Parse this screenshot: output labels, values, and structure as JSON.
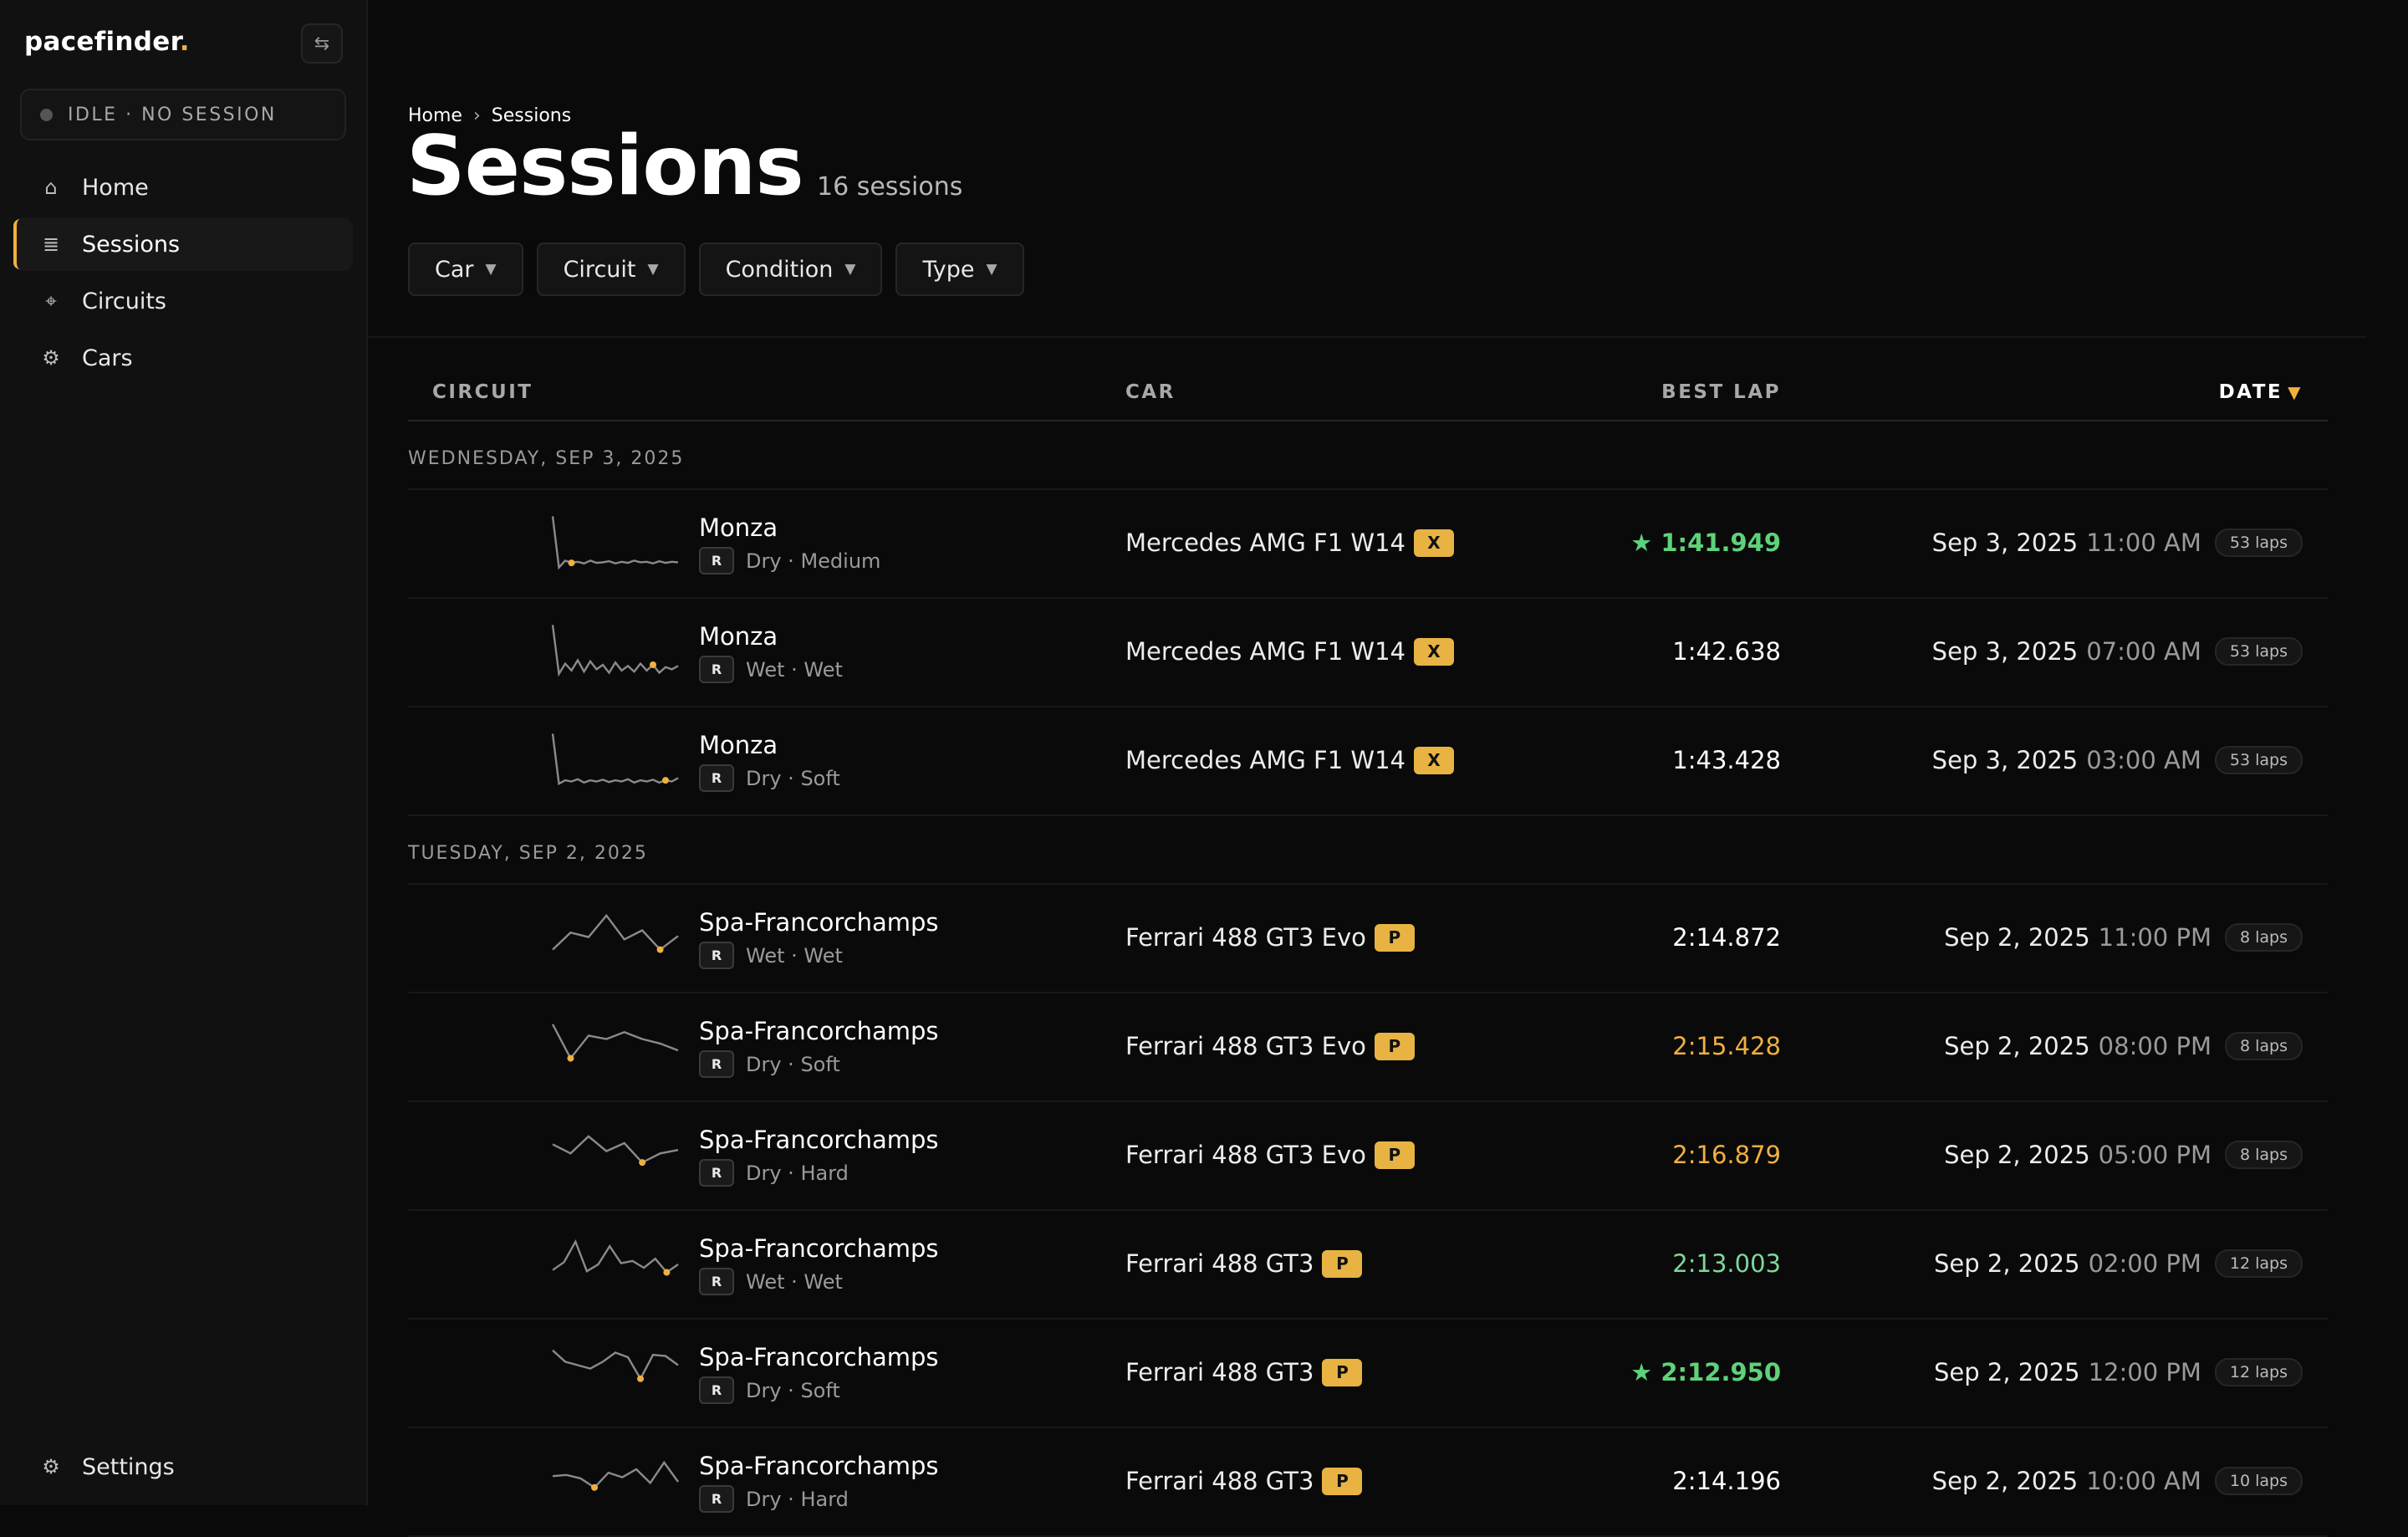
{
  "app": {
    "brand": "pacefinder",
    "brand_dot": "."
  },
  "status": {
    "text": "IDLE · NO SESSION"
  },
  "nav": {
    "items": [
      {
        "label": "Home",
        "icon": "⌂"
      },
      {
        "label": "Sessions",
        "icon": "≣"
      },
      {
        "label": "Circuits",
        "icon": "⌖"
      },
      {
        "label": "Cars",
        "icon": "⚙"
      }
    ],
    "settings": {
      "label": "Settings",
      "icon": "⚙"
    }
  },
  "page": {
    "breadcrumb": {
      "home": "Home",
      "sep": "›",
      "current": "Sessions"
    },
    "title": "Sessions",
    "count": "16 sessions"
  },
  "filters": [
    {
      "label": "Car"
    },
    {
      "label": "Circuit"
    },
    {
      "label": "Condition"
    },
    {
      "label": "Type"
    }
  ],
  "table": {
    "headers": {
      "circuit": "CIRCUIT",
      "car": "CAR",
      "best_lap": "BEST LAP",
      "date": "DATE",
      "sort_icon": "▼"
    },
    "groups": [
      {
        "label": "WEDNESDAY, SEP 3, 2025",
        "rows": [
          {
            "circuit": "Monza",
            "badge": "R",
            "conditions": "Dry · Medium",
            "car": "Mercedes AMG F1 W14",
            "car_class": "X",
            "best_lap": "★ 1:41.949",
            "best_style": "pb",
            "date": "Sep 3, 2025",
            "time": "11:00 AM",
            "laps": "53 laps",
            "spark": [
              2,
              92,
              80,
              84,
              82,
              85,
              80,
              84,
              83,
              81,
              85,
              82,
              84,
              80,
              83,
              82,
              85,
              81,
              84,
              82,
              83
            ],
            "spark_best": 3
          },
          {
            "circuit": "Monza",
            "badge": "R",
            "conditions": "Wet · Wet",
            "car": "Mercedes AMG F1 W14",
            "car_class": "X",
            "best_lap": "1:42.638",
            "best_style": "normal",
            "date": "Sep 3, 2025",
            "time": "07:00 AM",
            "laps": "53 laps",
            "spark": [
              2,
              88,
              70,
              82,
              64,
              84,
              66,
              80,
              72,
              86,
              68,
              82,
              74,
              84,
              70,
              82,
              72,
              86,
              76,
              80,
              74
            ],
            "spark_best": 16
          },
          {
            "circuit": "Monza",
            "badge": "R",
            "conditions": "Dry · Soft",
            "car": "Mercedes AMG F1 W14",
            "car_class": "X",
            "best_lap": "1:43.428",
            "best_style": "normal",
            "date": "Sep 3, 2025",
            "time": "03:00 AM",
            "laps": "53 laps",
            "spark": [
              2,
              90,
              84,
              86,
              82,
              88,
              84,
              86,
              83,
              87,
              84,
              86,
              82,
              88,
              84,
              86,
              83,
              88,
              84,
              86,
              80
            ],
            "spark_best": 18
          }
        ]
      },
      {
        "label": "TUESDAY, SEP 2, 2025",
        "rows": [
          {
            "circuit": "Spa-Francorchamps",
            "badge": "R",
            "conditions": "Wet · Wet",
            "car": "Ferrari 488 GT3 Evo",
            "car_class": "P",
            "best_lap": "2:14.872",
            "best_style": "normal",
            "date": "Sep 2, 2025",
            "time": "11:00 PM",
            "laps": "8 laps",
            "spark": [
              70,
              40,
              48,
              10,
              52,
              36,
              70,
              46
            ],
            "spark_best": 6
          },
          {
            "circuit": "Spa-Francorchamps",
            "badge": "R",
            "conditions": "Dry · Soft",
            "car": "Ferrari 488 GT3 Evo",
            "car_class": "P",
            "best_lap": "2:15.428",
            "best_style": "orange",
            "date": "Sep 2, 2025",
            "time": "08:00 PM",
            "laps": "8 laps",
            "spark": [
              10,
              70,
              30,
              36,
              24,
              36,
              44,
              56
            ],
            "spark_best": 1
          },
          {
            "circuit": "Spa-Francorchamps",
            "badge": "R",
            "conditions": "Dry · Hard",
            "car": "Ferrari 488 GT3 Evo",
            "car_class": "P",
            "best_lap": "2:16.879",
            "best_style": "orange",
            "date": "Sep 2, 2025",
            "time": "05:00 PM",
            "laps": "8 laps",
            "spark": [
              30,
              46,
              16,
              42,
              28,
              62,
              46,
              40
            ],
            "spark_best": 5
          },
          {
            "circuit": "Spa-Francorchamps",
            "badge": "R",
            "conditions": "Wet · Wet",
            "car": "Ferrari 488 GT3",
            "car_class": "P",
            "best_lap": "2:13.003",
            "best_style": "green",
            "date": "Sep 2, 2025",
            "time": "02:00 PM",
            "laps": "12 laps",
            "spark": [
              60,
              46,
              10,
              62,
              50,
              18,
              48,
              44,
              56,
              40,
              64,
              50
            ],
            "spark_best": 10
          },
          {
            "circuit": "Spa-Francorchamps",
            "badge": "R",
            "conditions": "Dry · Soft",
            "car": "Ferrari 488 GT3",
            "car_class": "P",
            "best_lap": "★ 2:12.950",
            "best_style": "pb",
            "date": "Sep 2, 2025",
            "time": "12:00 PM",
            "laps": "12 laps",
            "spark": [
              10,
              30,
              36,
              42,
              30,
              14,
              22,
              60,
              18,
              20,
              36
            ],
            "spark_best": 7
          },
          {
            "circuit": "Spa-Francorchamps",
            "badge": "R",
            "conditions": "Dry · Hard",
            "car": "Ferrari 488 GT3",
            "car_class": "P",
            "best_lap": "2:14.196",
            "best_style": "normal",
            "date": "Sep 2, 2025",
            "time": "10:00 AM",
            "laps": "10 laps",
            "spark": [
              40,
              38,
              44,
              60,
              34,
              42,
              28,
              52,
              16,
              50
            ],
            "spark_best": 3
          }
        ]
      }
    ]
  },
  "colors": {
    "accent": "#f0b040",
    "pb_green": "#5ed27a",
    "class_badge": "#e8b343"
  }
}
